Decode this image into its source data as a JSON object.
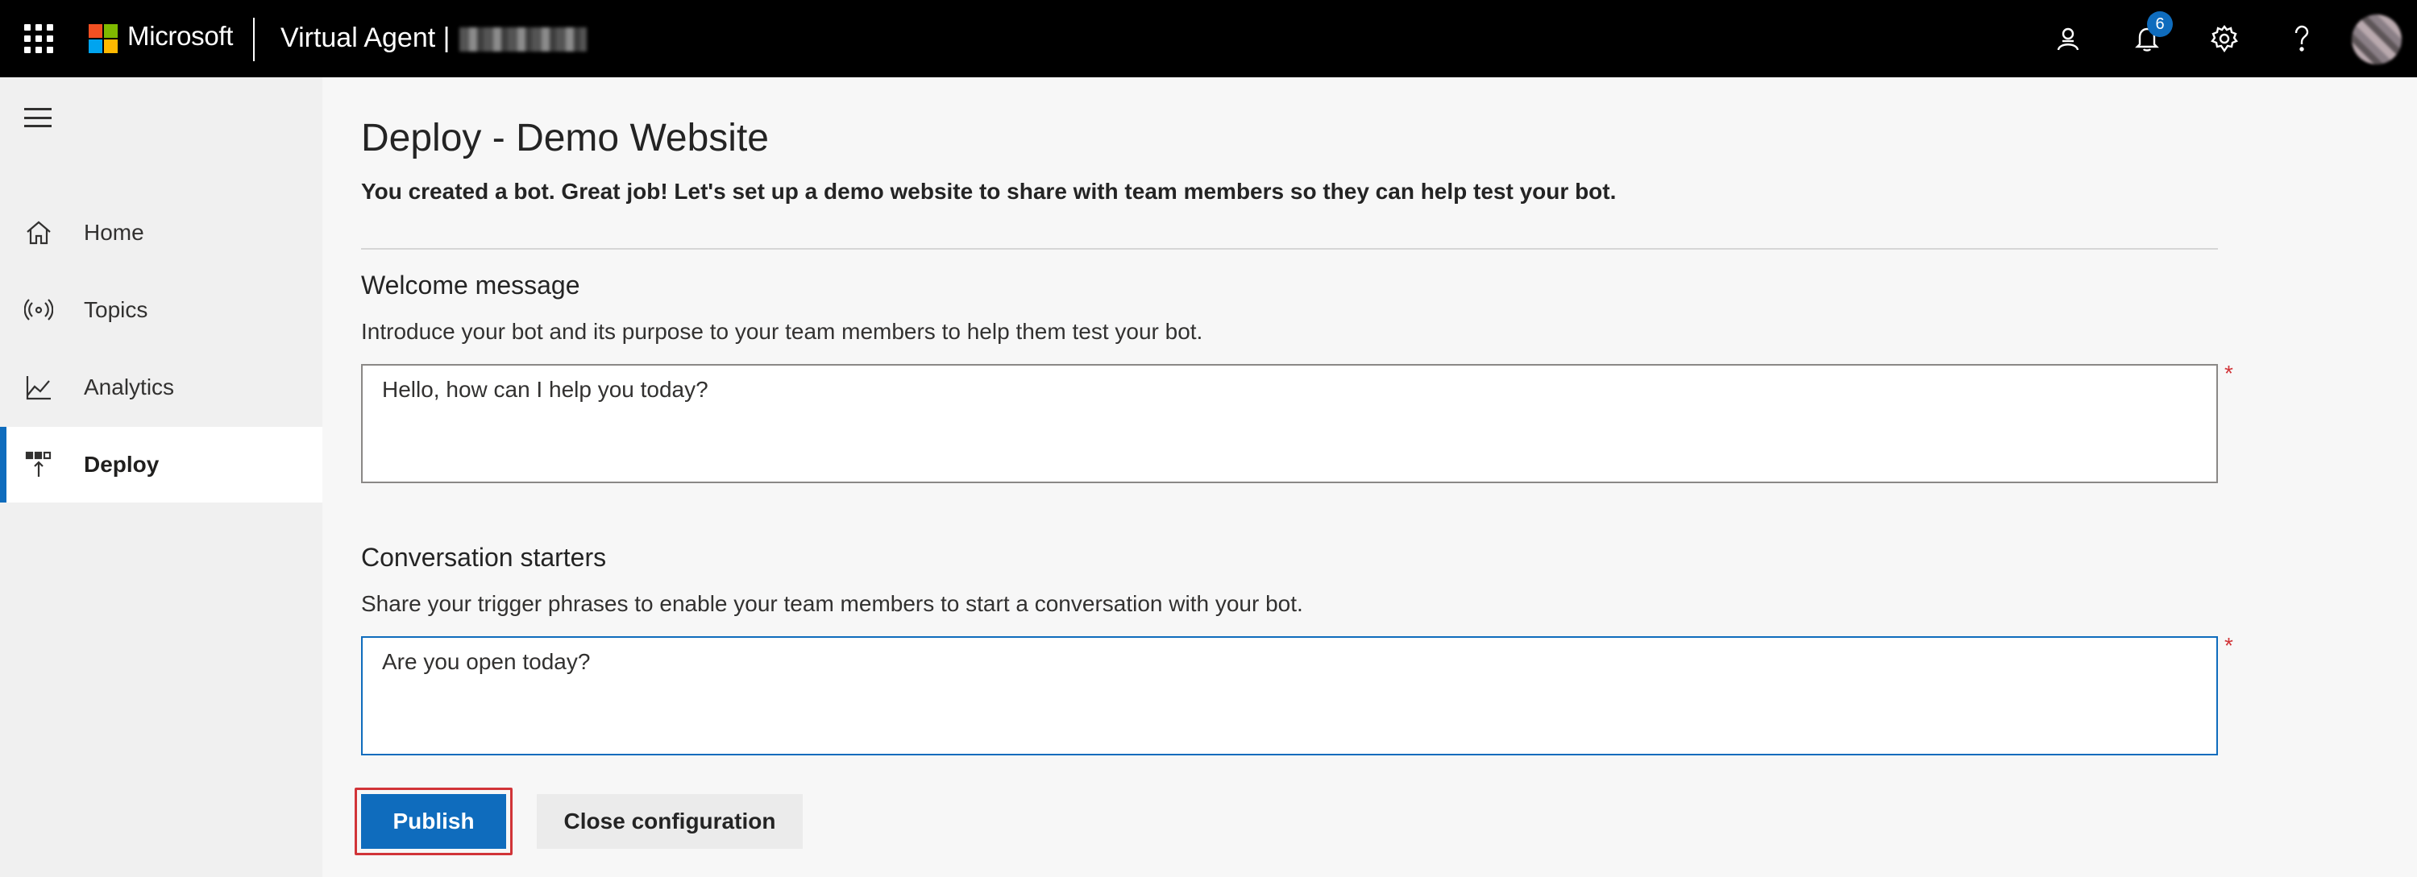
{
  "header": {
    "brand": "Microsoft",
    "app_title": "Virtual Agent |",
    "environment_name_obscured": "",
    "notification_count": "6",
    "icons": [
      "waffle-icon",
      "microsoft-logo",
      "person-icon",
      "bell-icon",
      "gear-icon",
      "help-icon",
      "avatar"
    ]
  },
  "sidebar": {
    "items": [
      {
        "label": "Home",
        "icon": "home-icon"
      },
      {
        "label": "Topics",
        "icon": "topics-icon"
      },
      {
        "label": "Analytics",
        "icon": "analytics-icon"
      },
      {
        "label": "Deploy",
        "icon": "deploy-icon",
        "active": true
      }
    ]
  },
  "main": {
    "title": "Deploy - Demo Website",
    "intro": "You created a bot. Great job! Let's set up a demo website to share with team members so they can help test your bot.",
    "welcome": {
      "title": "Welcome message",
      "description": "Introduce your bot and its purpose to your team members to help them test your bot.",
      "value": "Hello, how can I help you today?",
      "required": "*"
    },
    "starters": {
      "title": "Conversation starters",
      "description": "Share your trigger phrases to enable your team members to start a conversation with your bot.",
      "value": "Are you open today?",
      "required": "*"
    },
    "buttons": {
      "publish": "Publish",
      "close": "Close configuration"
    }
  },
  "colors": {
    "accent": "#0f6cbd",
    "required": "#d13438",
    "highlight_outline": "#d13438",
    "topbar": "#000000"
  }
}
